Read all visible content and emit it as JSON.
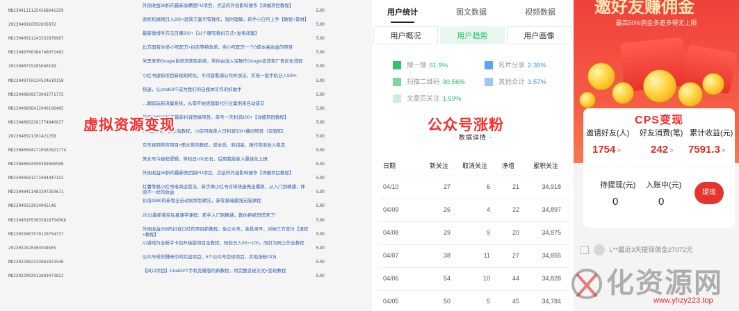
{
  "orders": [
    {
      "id": "MD23041111254568041259",
      "title": "外围收益38折的最新高精度FU项目，点这的外挂影响操作【详细项目教程】",
      "price": "5.00"
    },
    {
      "id": "2023040916592835072",
      "title": "宽松拓展网日入200+超简方案可零操作，短时理解，新手小白可上手【教程+素材】",
      "price": "5.00"
    },
    {
      "id": "MD23040911243552878967",
      "title": "最新微博手方法日赚200+【11个硬有稳抖方法+发条闭案】",
      "price": "5.00"
    },
    {
      "id": "MD23040706364746071463",
      "title": "比方面有99多小吃配方+抖应等特效单，卖小吃配方一个0成本高收益的项目",
      "price": "5.00"
    },
    {
      "id": "2023040715205040199",
      "title": "米黑老师Google自然流获取系统，带你由浅入深操作Google运营和广告优化流程",
      "price": "5.00"
    },
    {
      "id": "MD23040710324524619158",
      "title": "小红书虚拟项目新规则转化，不内容看通公司失误法，实现一部手机日入500+",
      "price": "5.00"
    },
    {
      "id": "MD23040609573043771775",
      "title": "快速，让chatGPT成为我们的自媒体写作的好助手",
      "price": "5.00"
    },
    {
      "id": "MD23040606412940106405",
      "title": "…跟踪玩新流量系统，从零开始搭建取代行业案例来自动成交",
      "price": "5.00"
    },
    {
      "id": "MD23040602261774840627",
      "title": "外围收益38折的最新抖音团搞项目，单号一天利润100+【详细项目教程】",
      "price": "5.00"
    },
    {
      "id": "2023040521101421258",
      "title": "3月最新来你企业淘教程，小白可做单人日利润500+撸创项目（仅暗知）",
      "price": "5.00"
    },
    {
      "id": "MD230405041710502821774",
      "title": "京东视频带货项目+图文带货教程，成本低、利润高、操作简单收入稳定",
      "price": "5.00"
    },
    {
      "id": "MD23040502050383056508",
      "title": "美女号冷启程逻辑，单机日100左右，后期我能收入最佳化上操",
      "price": "5.00"
    },
    {
      "id": "MD23040501271084447152",
      "title": "外围收益38折的最新美团搞FU项目，点这的外挂影响操作【详细项目教程】",
      "price": "5.00"
    },
    {
      "id": "MD23040411483307359671",
      "title": "红薯等路小红书电商运营法，新手做小红书对带快速做出爆款，从入门到精通，体验不一样的收益",
      "price": "5.00"
    },
    {
      "id": "MD23040323014045146",
      "title": "价值1980的新程全自动视频剪辑法，新零基础最强无脑课程",
      "price": "5.00"
    },
    {
      "id": "MD230401053035818754566",
      "title": "2023最新我在私募课学课程：新手入门到精通，教你拒绝恐慌来了!",
      "price": "5.00"
    },
    {
      "id": "MD23033007570120754737",
      "title": "外围收益288的抖音口红的项目新教程，免公众号，免投资号，对她三方支付【课程+教程】",
      "price": "5.00"
    },
    {
      "id": "2023032920303938565",
      "title": "小游戏行业新手卡包升级版项目全教程，轻松日入50～100，同打为网上作业教程",
      "price": "5.00"
    },
    {
      "id": "MD23032902333861823546",
      "title": "公众号带货赚来你的实战项目，5个公众号变现项目，实现涨粉23万",
      "price": "5.00"
    },
    {
      "id": "MD23032902013683473822",
      "title": "【风口项目】ChatGPT手机克隆版的新教程，附完整变现方式+变现教程",
      "price": "5.00"
    }
  ],
  "overlay_labels": {
    "left": "虚拟资源变现",
    "middle": "公众号涨粉",
    "right": "CPS变现"
  },
  "stats_panel": {
    "tabs": [
      "用户统计",
      "图文数据",
      "视频数据"
    ],
    "subtabs": [
      "用户概况",
      "用户趋势",
      "用户画像"
    ],
    "sources": [
      {
        "label": "搜一搜",
        "pct": "61.9%",
        "color": "#2fc26b"
      },
      {
        "label": "名片分享",
        "pct": "2.38%",
        "color": "#5aa6f0"
      },
      {
        "label": "扫描二维码",
        "pct": "30.56%",
        "color": "#7fd6a2"
      },
      {
        "label": "其他合计",
        "pct": "3.57%",
        "color": "#9bc8f4"
      },
      {
        "label": "文章页关注",
        "pct": "1.59%",
        "color": "#c8f0d8"
      }
    ],
    "detail_title": "· 数据详情 ·",
    "columns": [
      "日期",
      "新关注",
      "取消关注",
      "净增",
      "累积关注"
    ],
    "rows": [
      {
        "date": "04/10",
        "new": "27",
        "cancel": "6",
        "net": "21",
        "total": "34,918"
      },
      {
        "date": "04/09",
        "new": "26",
        "cancel": "4",
        "net": "22",
        "total": "34,897"
      },
      {
        "date": "04/08",
        "new": "29",
        "cancel": "9",
        "net": "20",
        "total": "34,875"
      },
      {
        "date": "04/07",
        "new": "38",
        "cancel": "11",
        "net": "27",
        "total": "34,855"
      },
      {
        "date": "04/06",
        "new": "54",
        "cancel": "10",
        "net": "44",
        "total": "34,828"
      },
      {
        "date": "04/05",
        "new": "50",
        "cancel": "5",
        "net": "45",
        "total": "34,784"
      }
    ]
  },
  "cps_panel": {
    "hero_title": "邀好友赚佣金",
    "hero_subtitle": "最高50%佣金多邀多得无上限",
    "stats": [
      {
        "label": "邀请好友(人)",
        "value": "1754"
      },
      {
        "label": "好友消费(笔)",
        "value": "242"
      },
      {
        "label": "累计收益(元)",
        "value": "7591.3"
      }
    ],
    "arrow": ">",
    "pending": {
      "label": "待提现(元)",
      "value": "0"
    },
    "incoming": {
      "label": "入账中(元)",
      "value": "0"
    },
    "withdraw_label": "提现",
    "notice": "L**最近3天提现佣金27072元"
  },
  "watermark": {
    "text": "化资源网",
    "url": "www.yhzy223.top"
  },
  "colors": {
    "accent_red": "#e8322c",
    "green": "#22c06a",
    "link_blue": "#2a5db0"
  }
}
